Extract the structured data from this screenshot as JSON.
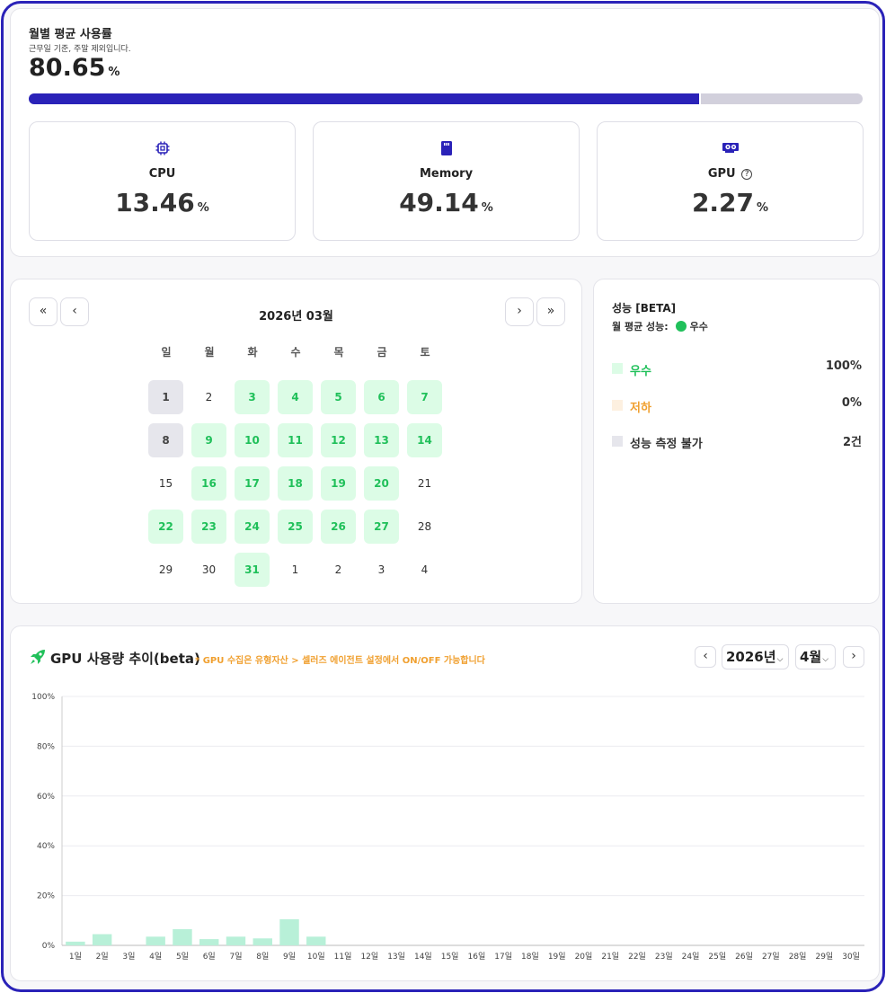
{
  "usage": {
    "title": "월별 평균 사용률",
    "subtitle": "근무일 기준, 주말 제외입니다.",
    "value": "80.65",
    "unit": "%",
    "progress_percent": 80.65
  },
  "metrics": [
    {
      "label": "CPU",
      "value": "13.46",
      "unit": "%",
      "icon": "cpu-icon"
    },
    {
      "label": "Memory",
      "value": "49.14",
      "unit": "%",
      "icon": "memory-icon"
    },
    {
      "label": "GPU",
      "value": "2.27",
      "unit": "%",
      "icon": "gpu-icon",
      "help": "?"
    }
  ],
  "calendar": {
    "title": "2026년 03월",
    "nav": {
      "first": "«",
      "prev": "‹",
      "next": "›",
      "last": "»"
    },
    "weekdays": [
      "일",
      "월",
      "화",
      "수",
      "목",
      "금",
      "토"
    ],
    "days": [
      {
        "d": "1",
        "s": "na"
      },
      {
        "d": "2",
        "s": ""
      },
      {
        "d": "3",
        "s": "good"
      },
      {
        "d": "4",
        "s": "good"
      },
      {
        "d": "5",
        "s": "good"
      },
      {
        "d": "6",
        "s": "good"
      },
      {
        "d": "7",
        "s": "good"
      },
      {
        "d": "8",
        "s": "na"
      },
      {
        "d": "9",
        "s": "good"
      },
      {
        "d": "10",
        "s": "good"
      },
      {
        "d": "11",
        "s": "good"
      },
      {
        "d": "12",
        "s": "good"
      },
      {
        "d": "13",
        "s": "good"
      },
      {
        "d": "14",
        "s": "good"
      },
      {
        "d": "15",
        "s": ""
      },
      {
        "d": "16",
        "s": "good"
      },
      {
        "d": "17",
        "s": "good"
      },
      {
        "d": "18",
        "s": "good"
      },
      {
        "d": "19",
        "s": "good"
      },
      {
        "d": "20",
        "s": "good"
      },
      {
        "d": "21",
        "s": ""
      },
      {
        "d": "22",
        "s": "good"
      },
      {
        "d": "23",
        "s": "good"
      },
      {
        "d": "24",
        "s": "good"
      },
      {
        "d": "25",
        "s": "good"
      },
      {
        "d": "26",
        "s": "good"
      },
      {
        "d": "27",
        "s": "good"
      },
      {
        "d": "28",
        "s": ""
      },
      {
        "d": "29",
        "s": ""
      },
      {
        "d": "30",
        "s": ""
      },
      {
        "d": "31",
        "s": "good"
      },
      {
        "d": "1",
        "s": ""
      },
      {
        "d": "2",
        "s": ""
      },
      {
        "d": "3",
        "s": ""
      },
      {
        "d": "4",
        "s": ""
      }
    ]
  },
  "performance": {
    "title": "성능 [BETA]",
    "monthly_label": "월 평균 성능:",
    "monthly_value": "우수",
    "legend": [
      {
        "label": "우수",
        "value": "100%",
        "color": "#20c05a",
        "swatch": "#dcfce6"
      },
      {
        "label": "저하",
        "value": "0%",
        "color": "#f0a030",
        "swatch": "#fdf0e0"
      },
      {
        "label": "성능 측정 불가",
        "value": "2건",
        "color": "#333333",
        "swatch": "#e6e6ec"
      }
    ]
  },
  "gpu_trend": {
    "title": "GPU 사용량 추이(beta)",
    "note": "* GPU 수집은 유형자산 > 셀러즈 에이전트 설정에서 ON/OFF 가능합니다",
    "year": "2026년",
    "month": "4월",
    "prev": "‹",
    "next": "›"
  },
  "chart_data": {
    "type": "bar",
    "categories": [
      "1일",
      "2일",
      "3일",
      "4일",
      "5일",
      "6일",
      "7일",
      "8일",
      "9일",
      "10일",
      "11일",
      "12일",
      "13일",
      "14일",
      "15일",
      "16일",
      "17일",
      "18일",
      "19일",
      "20일",
      "21일",
      "22일",
      "23일",
      "24일",
      "25일",
      "26일",
      "27일",
      "28일",
      "29일",
      "30일"
    ],
    "values": [
      1.5,
      4.5,
      0,
      3.5,
      6.5,
      2.5,
      3.5,
      2.8,
      10.5,
      3.5,
      0,
      0,
      0,
      0,
      0,
      0,
      0,
      0,
      0,
      0,
      0,
      0,
      0,
      0,
      0,
      0,
      0,
      0,
      0,
      0
    ],
    "ylim": [
      0,
      100
    ],
    "yticks": [
      "0%",
      "20%",
      "40%",
      "60%",
      "80%",
      "100%"
    ],
    "bar_color": "#b8f0d8",
    "grid": true
  }
}
